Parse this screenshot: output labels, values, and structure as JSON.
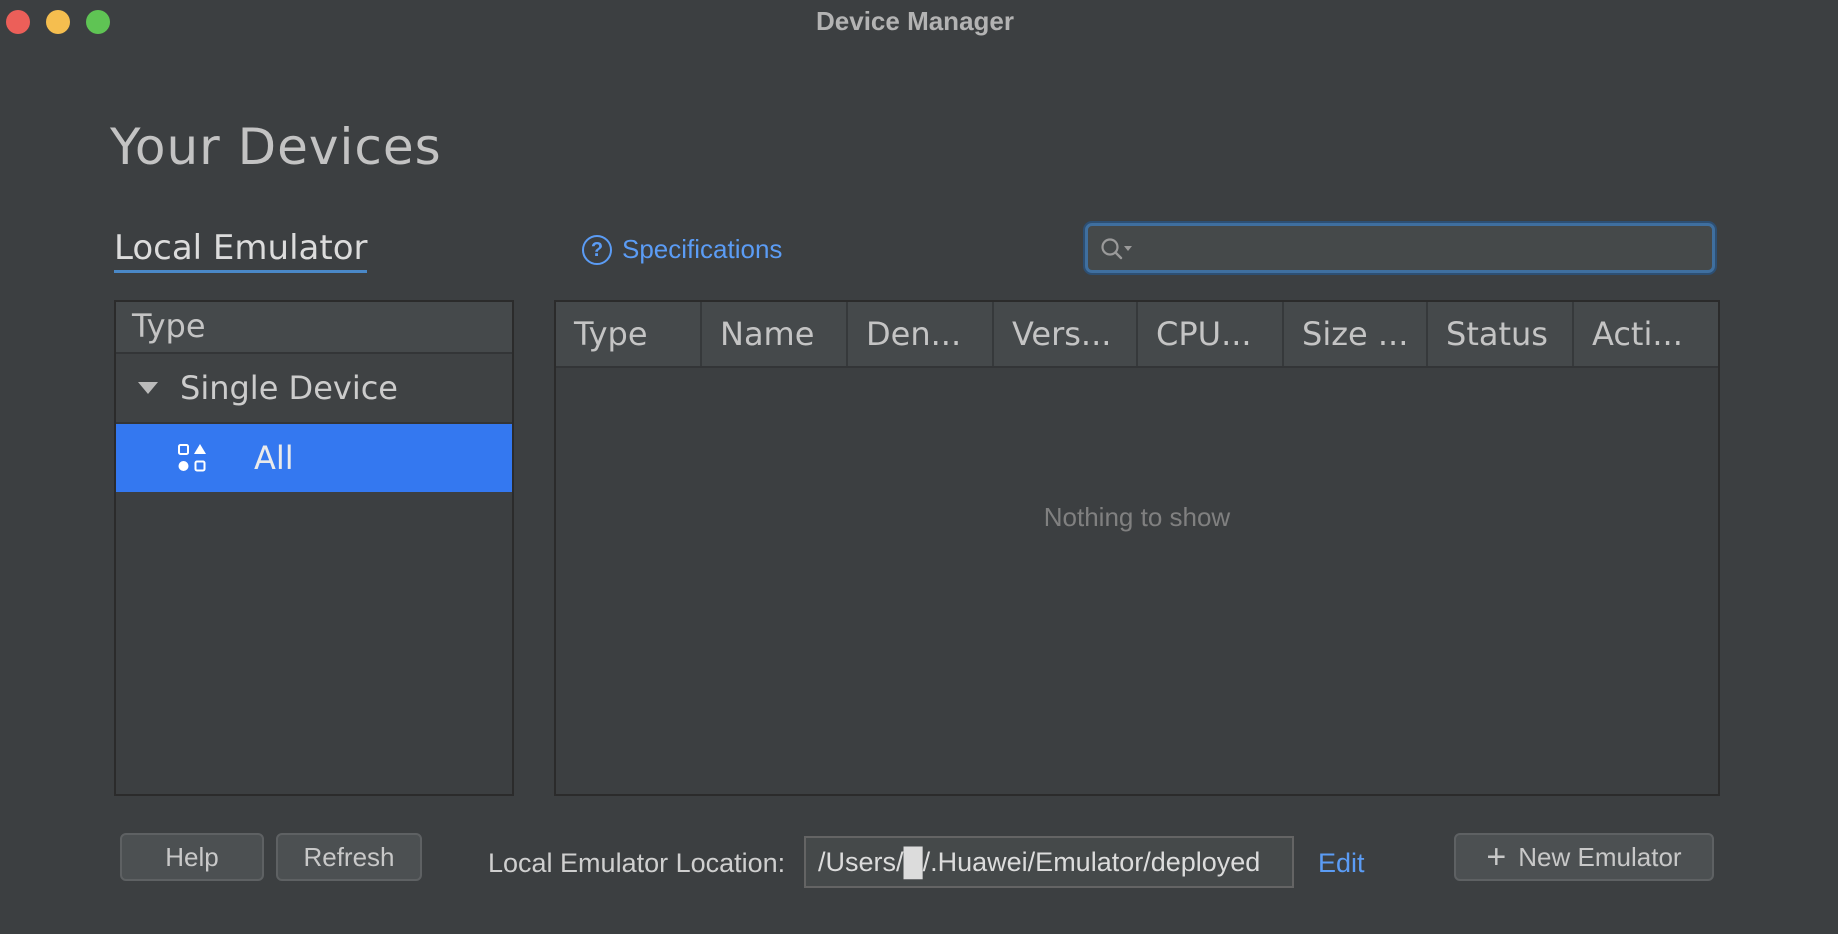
{
  "window": {
    "title": "Device Manager"
  },
  "page": {
    "title": "Your Devices"
  },
  "tabs": {
    "local_emulator": "Local Emulator"
  },
  "specifications": {
    "label": "Specifications",
    "icon": "help-circle-icon"
  },
  "search": {
    "placeholder": "",
    "value": ""
  },
  "type_panel": {
    "header": "Type",
    "group": "Single Device",
    "selected_item": "All"
  },
  "table": {
    "columns": [
      "Type",
      "Name",
      "Den...",
      "Vers...",
      "CPU...",
      "Size ...",
      "Status",
      "Acti..."
    ],
    "empty_text": "Nothing to show"
  },
  "footer": {
    "help_label": "Help",
    "refresh_label": "Refresh",
    "location_label": "Local Emulator Location:",
    "location_value": "/Users/█/.Huawei/Emulator/deployed",
    "edit_label": "Edit",
    "new_emulator_label": "New Emulator"
  },
  "colors": {
    "background": "#3c3f41",
    "accent": "#3478f0",
    "link": "#5b9cf5"
  }
}
